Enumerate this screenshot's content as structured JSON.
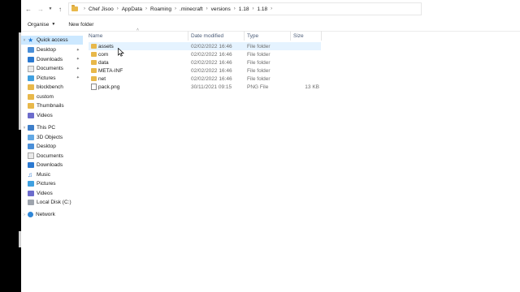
{
  "address": {
    "crumbs": [
      "Chef Jisoo",
      "AppData",
      "Roaming",
      ".minecraft",
      "versions",
      "1.18",
      "1.18"
    ]
  },
  "commands": {
    "organise": "Organise",
    "new_folder": "New folder"
  },
  "columns": {
    "name": "Name",
    "date": "Date modified",
    "type": "Type",
    "size": "Size"
  },
  "nav": {
    "quick_access": "Quick access",
    "quick_items": [
      "Desktop",
      "Downloads",
      "Documents",
      "Pictures",
      "blockbench",
      "custom",
      "Thumbnails",
      "Videos"
    ],
    "this_pc": "This PC",
    "pc_items": [
      "3D Objects",
      "Desktop",
      "Documents",
      "Downloads",
      "Music",
      "Pictures",
      "Videos",
      "Local Disk (C:)"
    ],
    "network": "Network"
  },
  "files": [
    {
      "name": "assets",
      "date": "02/02/2022 16:46",
      "type": "File folder",
      "size": ""
    },
    {
      "name": "com",
      "date": "02/02/2022 16:46",
      "type": "File folder",
      "size": ""
    },
    {
      "name": "data",
      "date": "02/02/2022 16:46",
      "type": "File folder",
      "size": ""
    },
    {
      "name": "META-INF",
      "date": "02/02/2022 16:46",
      "type": "File folder",
      "size": ""
    },
    {
      "name": "net",
      "date": "02/02/2022 16:46",
      "type": "File folder",
      "size": ""
    },
    {
      "name": "pack.png",
      "date": "30/11/2021 09:15",
      "type": "PNG File",
      "size": "13 KB"
    }
  ],
  "colors": {
    "selected": "#cce8ff",
    "hover": "#e5f3ff",
    "folder": "#e8b84a",
    "header_text": "#4a5b77"
  }
}
